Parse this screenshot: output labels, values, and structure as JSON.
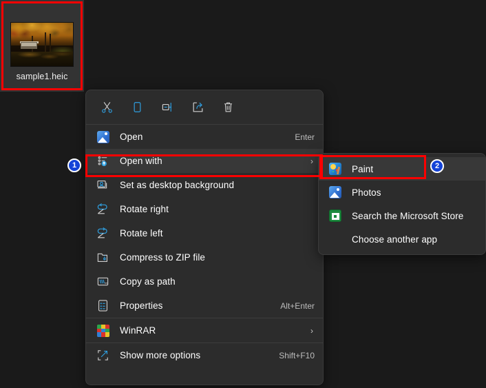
{
  "desktop": {
    "background_color": "#1a1a1a",
    "file": {
      "name": "sample1.heic",
      "thumbnail_alt": "autumn-forest-cabin-photo",
      "selected": true,
      "selection_color": "#333333"
    }
  },
  "annotations": {
    "badges": [
      {
        "id": "1",
        "label": "1",
        "color": "#1443d8",
        "target": "open-with-menu-item"
      },
      {
        "id": "2",
        "label": "2",
        "color": "#1443d8",
        "target": "paint-submenu-item"
      }
    ],
    "highlight_boxes": [
      {
        "name": "file-highlight",
        "color": "#ff0000"
      },
      {
        "name": "open-with-highlight",
        "color": "#ff0000"
      },
      {
        "name": "paint-highlight",
        "color": "#ff0000"
      }
    ]
  },
  "context_menu": {
    "background_color": "#2c2c2c",
    "toolbar": [
      {
        "name": "cut",
        "icon": "scissors-icon",
        "label": "Cut"
      },
      {
        "name": "copy",
        "icon": "copy-icon",
        "label": "Copy"
      },
      {
        "name": "rename",
        "icon": "rename-icon",
        "label": "Rename"
      },
      {
        "name": "share",
        "icon": "share-icon",
        "label": "Share"
      },
      {
        "name": "delete",
        "icon": "trash-icon",
        "label": "Delete"
      }
    ],
    "items": [
      {
        "label": "Open",
        "accel": "Enter",
        "icon": "photos-icon",
        "submenu": false,
        "highlighted": false
      },
      {
        "label": "Open with",
        "accel": "",
        "icon": "open-with-icon",
        "submenu": true,
        "highlighted": true
      },
      {
        "label": "Set as desktop background",
        "accel": "",
        "icon": "desktop-background-icon",
        "submenu": false,
        "highlighted": false
      },
      {
        "label": "Rotate right",
        "accel": "",
        "icon": "rotate-right-icon",
        "submenu": false,
        "highlighted": false
      },
      {
        "label": "Rotate left",
        "accel": "",
        "icon": "rotate-left-icon",
        "submenu": false,
        "highlighted": false
      },
      {
        "label": "Compress to ZIP file",
        "accel": "",
        "icon": "zip-icon",
        "submenu": false,
        "highlighted": false
      },
      {
        "label": "Copy as path",
        "accel": "",
        "icon": "copy-path-icon",
        "submenu": false,
        "highlighted": false
      },
      {
        "label": "Properties",
        "accel": "Alt+Enter",
        "icon": "properties-icon",
        "submenu": false,
        "highlighted": false
      },
      {
        "label": "WinRAR",
        "accel": "",
        "icon": "winrar-icon",
        "submenu": true,
        "highlighted": false
      },
      {
        "label": "Show more options",
        "accel": "Shift+F10",
        "icon": "show-more-icon",
        "submenu": false,
        "highlighted": false
      }
    ]
  },
  "submenu": {
    "background_color": "#2c2c2c",
    "items": [
      {
        "label": "Paint",
        "icon": "paint-icon",
        "highlighted": true
      },
      {
        "label": "Photos",
        "icon": "photos-icon",
        "highlighted": false
      },
      {
        "label": "Search the Microsoft Store",
        "icon": "microsoft-store-icon",
        "highlighted": false
      },
      {
        "label": "Choose another app",
        "icon": "",
        "highlighted": false
      }
    ]
  }
}
